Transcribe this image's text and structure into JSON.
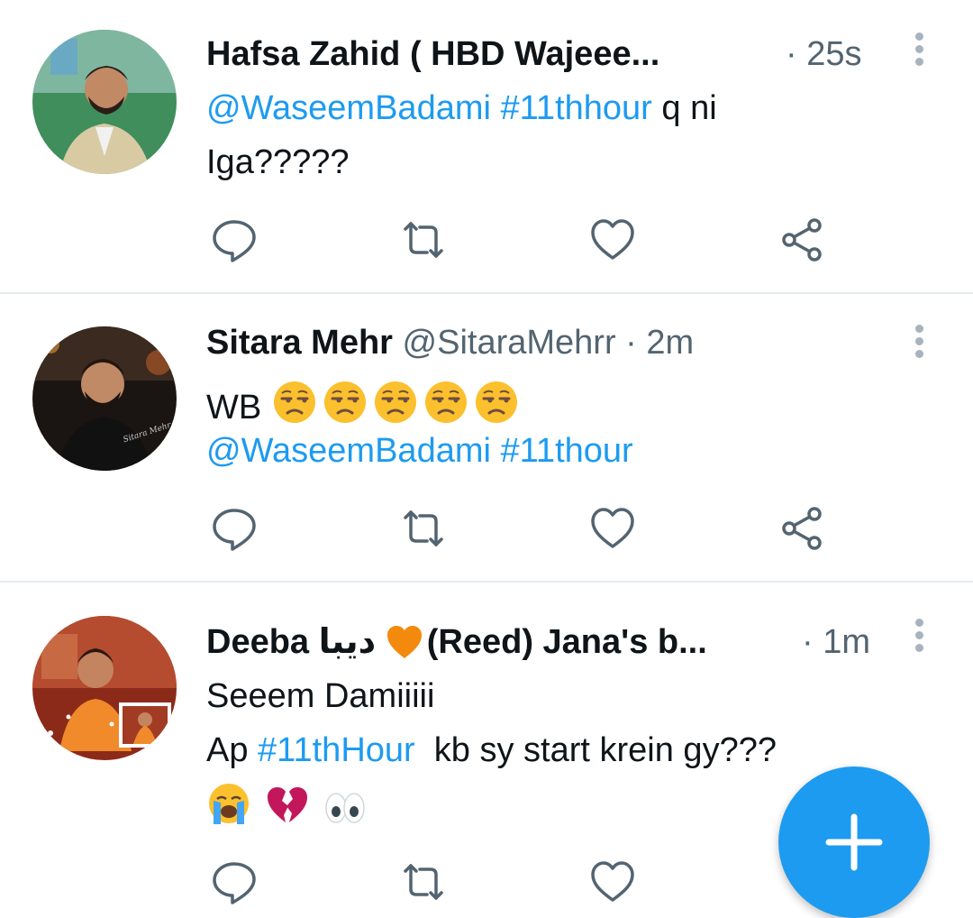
{
  "tweets": [
    {
      "name": "Hafsa Zahid ( HBD Wajeee...",
      "handle": "",
      "time": "· 25s",
      "lines": [
        {
          "link": "@WaseemBadami #11thhour",
          "text": " q ni"
        },
        {
          "text": "Iga?????"
        }
      ]
    },
    {
      "name": "Sitara Mehr",
      "handle": "@SitaraMehrr",
      "time": "· 2m",
      "line1": "WB",
      "line2_link": "@WaseemBadami #11thour"
    },
    {
      "name": "Deeba",
      "name_urdu": "دیبا",
      "name_rest": "(Reed) Jana's b...",
      "time": "· 1m",
      "line1": "Seeem Damiiiii",
      "line2_pre": "Ap ",
      "line2_link": "#11thHour",
      "line2_post": "  kb sy start krein gy???"
    }
  ],
  "avatar_watermark": "Sitara Mehr",
  "icons": {
    "reply": "reply-icon",
    "retweet": "retweet-icon",
    "like": "heart-icon",
    "share": "share-icon",
    "more": "more-vertical-icon",
    "compose": "plus-icon"
  },
  "colors": {
    "accent": "#1d9bf0",
    "text": "#0f1419",
    "secondary": "#536471",
    "divider": "#e6ecf0"
  }
}
